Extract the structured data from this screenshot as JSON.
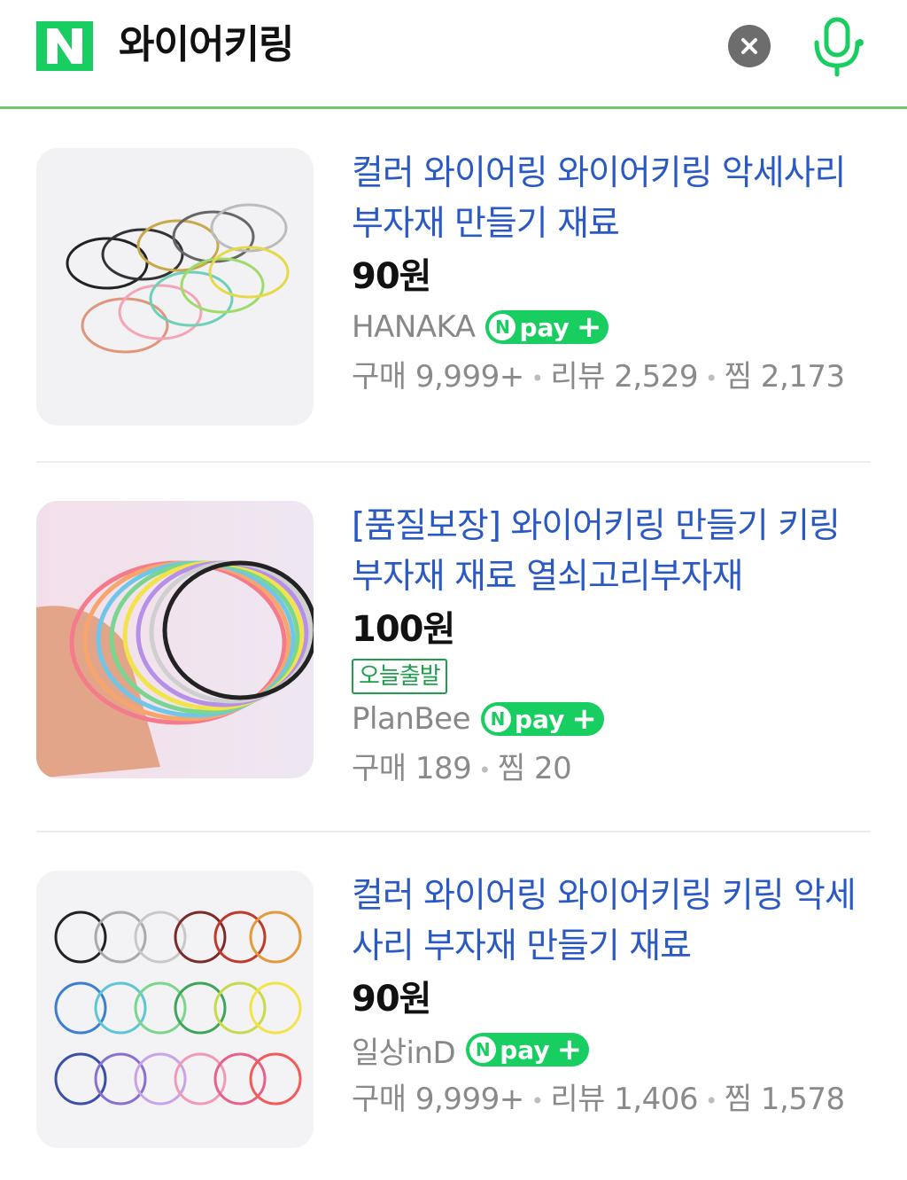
{
  "search": {
    "logo_letter": "N",
    "query": "와이어키링",
    "clear_icon": "close-icon",
    "mic_icon": "microphone-icon",
    "accent": "#19ce60"
  },
  "products": [
    {
      "title": "컬러 와이어링 와이어키링 악세사리 부자재 만들기 재료",
      "price": "90원",
      "badge": "",
      "seller": "HANAKA",
      "npay": "pay",
      "stats": [
        {
          "label": "구매 9,999+"
        },
        {
          "label": "리뷰 2,529"
        },
        {
          "label": "찜 2,173"
        }
      ]
    },
    {
      "title": "[품질보장] 와이어키링 만들기 키링 부자재 재료 열쇠고리부자재",
      "price": "100원",
      "badge": "오늘출발",
      "seller": "PlanBee",
      "npay": "pay",
      "stats": [
        {
          "label": "구매 189"
        },
        {
          "label": "찜 20"
        }
      ]
    },
    {
      "title": "컬러 와이어링 와이어키링 키링 악세사리 부자재 만들기 재료",
      "price": "90원",
      "badge": "",
      "seller": "일상inD",
      "npay": "pay",
      "stats": [
        {
          "label": "구매 9,999+"
        },
        {
          "label": "리뷰 1,406"
        },
        {
          "label": "찜 1,578"
        }
      ]
    }
  ]
}
